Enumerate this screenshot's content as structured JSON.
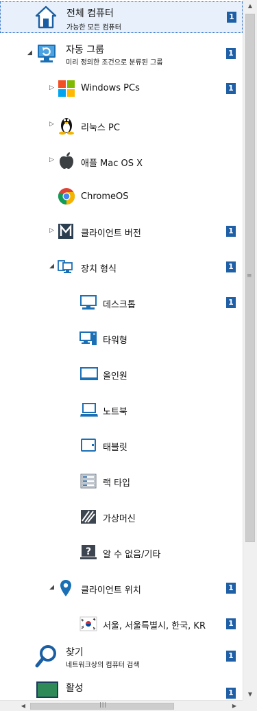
{
  "tree": {
    "all_computers": {
      "label": "전체 컴퓨터",
      "sub": "가능한 모든 컴퓨터",
      "badge": "1"
    },
    "auto_groups": {
      "label": "자동 그룹",
      "sub": "미리 정의한 조건으로 분류된 그룹",
      "badge": "1"
    },
    "windows": {
      "label": "Windows PCs",
      "badge": "1"
    },
    "linux": {
      "label": "리눅스 PC"
    },
    "mac": {
      "label": "애플 Mac OS X"
    },
    "chromeos": {
      "label": "ChromeOS"
    },
    "client_version": {
      "label": "클라이언트 버전",
      "badge": "1"
    },
    "device_type": {
      "label": "장치 형식",
      "badge": "1"
    },
    "desktop": {
      "label": "데스크톱",
      "badge": "1"
    },
    "tower": {
      "label": "타워형"
    },
    "allinone": {
      "label": "올인원"
    },
    "notebook": {
      "label": "노트북"
    },
    "tablet": {
      "label": "태블릿"
    },
    "rack": {
      "label": "랙 타입"
    },
    "virtual": {
      "label": "가상머신"
    },
    "unknown": {
      "label": "알 수 없음/기타"
    },
    "client_location": {
      "label": "클라이언트 위치",
      "badge": "1"
    },
    "seoul": {
      "label": "서울, 서울특별시, 한국, KR",
      "badge": "1"
    },
    "find": {
      "label": "찾기",
      "sub": "네트워크상의 컴퓨터 검색",
      "badge": "1"
    },
    "active": {
      "label": "활성",
      "badge": "1"
    }
  },
  "scrollbar": {
    "grip": "|||"
  }
}
